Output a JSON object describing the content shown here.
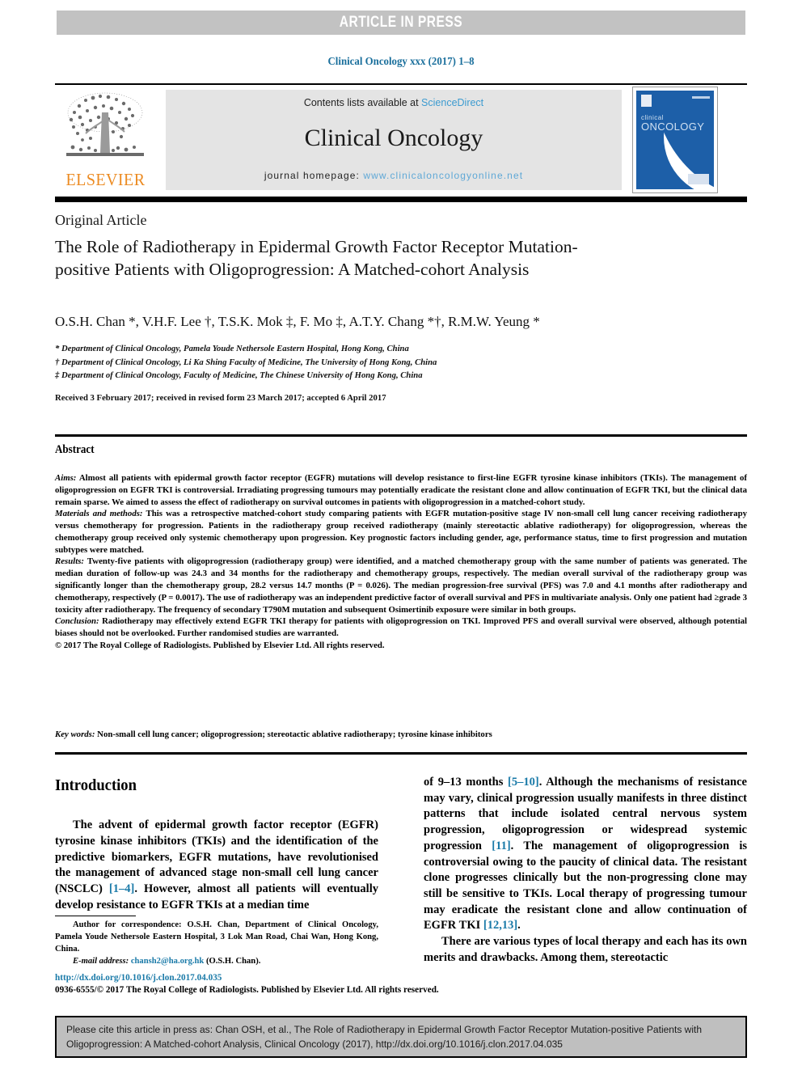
{
  "banner": {
    "text": "ARTICLE IN PRESS"
  },
  "running_head": "Clinical Oncology xxx (2017) 1–8",
  "masthead": {
    "publisher_name": "ELSEVIER",
    "contents_prefix": "Contents lists available at ",
    "contents_link": "ScienceDirect",
    "journal_name": "Clinical Oncology",
    "homepage_prefix": "journal homepage: ",
    "homepage_url": "www.clinicaloncologyonline.net",
    "cover_title_line1": "clinical",
    "cover_title_line2": "ONCOLOGY"
  },
  "article": {
    "type": "Original Article",
    "title": "The Role of Radiotherapy in Epidermal Growth Factor Receptor Mutation-positive Patients with Oligoprogression: A Matched-cohort Analysis",
    "authors": "O.S.H. Chan *, V.H.F. Lee †, T.S.K. Mok ‡, F. Mo ‡, A.T.Y. Chang *†, R.M.W. Yeung *",
    "affiliations": [
      "* Department of Clinical Oncology, Pamela Youde Nethersole Eastern Hospital, Hong Kong, China",
      "† Department of Clinical Oncology, Li Ka Shing Faculty of Medicine, The University of Hong Kong, China",
      "‡ Department of Clinical Oncology, Faculty of Medicine, The Chinese University of Hong Kong, China"
    ],
    "history": "Received 3 February 2017; received in revised form 23 March 2017; accepted 6 April 2017"
  },
  "abstract": {
    "heading": "Abstract",
    "sections": [
      {
        "label": "Aims:",
        "text": " Almost all patients with epidermal growth factor receptor (EGFR) mutations will develop resistance to first-line EGFR tyrosine kinase inhibitors (TKIs). The management of oligoprogression on EGFR TKI is controversial. Irradiating progressing tumours may potentially eradicate the resistant clone and allow continuation of EGFR TKI, but the clinical data remain sparse. We aimed to assess the effect of radiotherapy on survival outcomes in patients with oligoprogression in a matched-cohort study."
      },
      {
        "label": "Materials and methods:",
        "text": " This was a retrospective matched-cohort study comparing patients with EGFR mutation-positive stage IV non-small cell lung cancer receiving radiotherapy versus chemotherapy for progression. Patients in the radiotherapy group received radiotherapy (mainly stereotactic ablative radiotherapy) for oligoprogression, whereas the chemotherapy group received only systemic chemotherapy upon progression. Key prognostic factors including gender, age, performance status, time to first progression and mutation subtypes were matched."
      },
      {
        "label": "Results:",
        "text": " Twenty-five patients with oligoprogression (radiotherapy group) were identified, and a matched chemotherapy group with the same number of patients was generated. The median duration of follow-up was 24.3 and 34 months for the radiotherapy and chemotherapy groups, respectively. The median overall survival of the radiotherapy group was significantly longer than the chemotherapy group, 28.2 versus 14.7 months (P = 0.026). The median progression-free survival (PFS) was 7.0 and 4.1 months after radiotherapy and chemotherapy, respectively (P = 0.0017). The use of radiotherapy was an independent predictive factor of overall survival and PFS in multivariate analysis. Only one patient had ≥grade 3 toxicity after radiotherapy. The frequency of secondary T790M mutation and subsequent Osimertinib exposure were similar in both groups."
      },
      {
        "label": "Conclusion:",
        "text": " Radiotherapy may effectively extend EGFR TKI therapy for patients with oligoprogression on TKI. Improved PFS and overall survival were observed, although potential biases should not be overlooked. Further randomised studies are warranted."
      }
    ],
    "copyright": "© 2017 The Royal College of Radiologists. Published by Elsevier Ltd. All rights reserved.",
    "keywords_label": "Key words:",
    "keywords_text": " Non-small cell lung cancer; oligoprogression; stereotactic ablative radiotherapy; tyrosine kinase inhibitors"
  },
  "introduction": {
    "heading": "Introduction",
    "left_p1_a": "The advent of epidermal growth factor receptor (EGFR) tyrosine kinase inhibitors (TKIs) and the identification of the predictive biomarkers, EGFR mutations, have revolutionised the management of advanced stage non-small cell lung cancer (NSCLC) ",
    "left_ref1": "[1–4]",
    "left_p1_b": ". However, almost all patients will eventually develop resistance to EGFR TKIs at a median time",
    "right_p1_a": "of 9–13 months ",
    "right_ref1": "[5–10]",
    "right_p1_b": ". Although the mechanisms of resistance may vary, clinical progression usually manifests in three distinct patterns that include isolated central nervous system progression, oligoprogression or widespread systemic progression ",
    "right_ref2": "[11]",
    "right_p1_c": ". The management of oligoprogression is controversial owing to the paucity of clinical data. The resistant clone progresses clinically but the non-progressing clone may still be sensitive to TKIs. Local therapy of progressing tumour may eradicate the resistant clone and allow continuation of EGFR TKI ",
    "right_ref3": "[12,13]",
    "right_p1_d": ".",
    "right_p2": "There are various types of local therapy and each has its own merits and drawbacks. Among them, stereotactic"
  },
  "footnote": {
    "correspondence": "Author for correspondence: O.S.H. Chan, Department of Clinical Oncology, Pamela Youde Nethersole Eastern Hospital, 3 Lok Man Road, Chai Wan, Hong Kong, China.",
    "email_label": "E-mail address:",
    "email": "chansh2@ha.org.hk",
    "email_owner": " (O.S.H. Chan).",
    "doi": "http://dx.doi.org/10.1016/j.clon.2017.04.035",
    "issn_copyright": "0936-6555/© 2017 The Royal College of Radiologists. Published by Elsevier Ltd. All rights reserved."
  },
  "cite_box": {
    "text": "Please cite this article in press as: Chan OSH, et al., The Role of Radiotherapy in Epidermal Growth Factor Receptor Mutation-positive Patients with Oligoprogression: A Matched-cohort Analysis, Clinical Oncology (2017), http://dx.doi.org/10.1016/j.clon.2017.04.035"
  },
  "colors": {
    "link_blue": "#1a7aa8",
    "homepage_blue": "#5fa8d6",
    "sciencedirect_blue": "#3c9bd0",
    "elsevier_orange": "#ec8b22",
    "banner_grey": "#c2c2c2",
    "cite_box_grey": "#bfbfbf",
    "cover_blue": "#1d5fa8"
  }
}
